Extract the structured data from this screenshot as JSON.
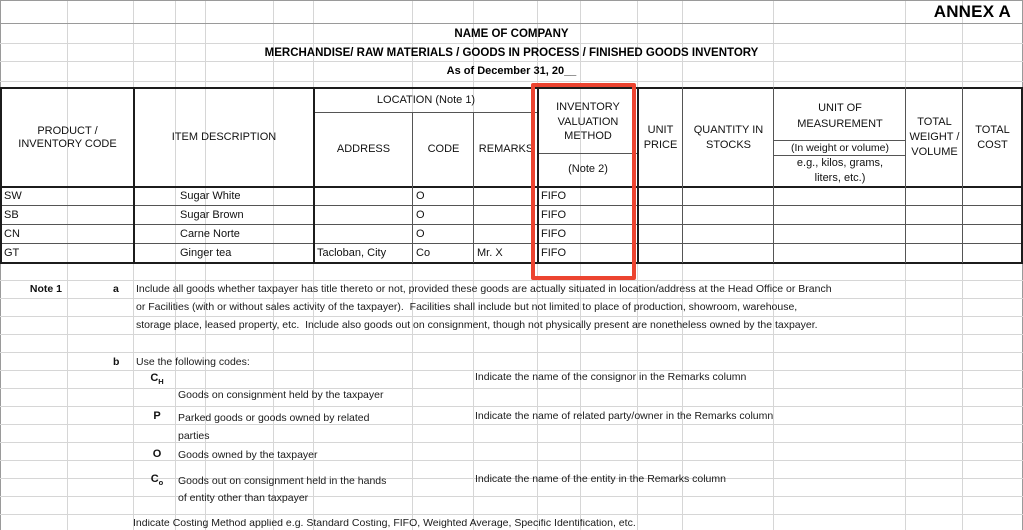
{
  "document": {
    "annex_label": "ANNEX A",
    "company_line": "NAME OF COMPANY",
    "form_title": "MERCHANDISE/ RAW MATERIALS / GOODS IN PROCESS / FINISHED GOODS INVENTORY",
    "as_of": "As of December 31, 20__"
  },
  "table": {
    "headers": {
      "product_code": "PRODUCT /\nINVENTORY CODE",
      "item_description": "ITEM DESCRIPTION",
      "location_group": "LOCATION (Note 1)",
      "address": "ADDRESS",
      "code": "CODE",
      "remarks": "REMARKS",
      "valuation_method_l1": "INVENTORY",
      "valuation_method_l2": "VALUATION",
      "valuation_method_l3": "METHOD",
      "valuation_method_note": "(Note 2)",
      "unit_price_l1": "UNIT",
      "unit_price_l2": "PRICE",
      "quantity_l1": "QUANTITY IN",
      "quantity_l2": "STOCKS",
      "uom_l1": "UNIT OF",
      "uom_l2": "MEASUREMENT",
      "uom_l3": "(In weight or volume)",
      "uom_l4": "e.g., kilos, grams,",
      "uom_l5": "liters, etc.)",
      "total_weight_l1": "TOTAL",
      "total_weight_l2": "WEIGHT /",
      "total_weight_l3": "VOLUME",
      "total_cost_l1": "TOTAL",
      "total_cost_l2": "COST"
    },
    "rows": [
      {
        "product_code": "SW",
        "item_description": "Sugar White",
        "address": "",
        "code": "O",
        "remarks": "",
        "valuation_method": "FIFO",
        "unit_price": "",
        "quantity": "",
        "uom": "",
        "total_weight": "",
        "total_cost": ""
      },
      {
        "product_code": "SB",
        "item_description": "Sugar Brown",
        "address": "",
        "code": "O",
        "remarks": "",
        "valuation_method": "FIFO",
        "unit_price": "",
        "quantity": "",
        "uom": "",
        "total_weight": "",
        "total_cost": ""
      },
      {
        "product_code": "CN",
        "item_description": "Carne Norte",
        "address": "",
        "code": "O",
        "remarks": "",
        "valuation_method": "FIFO",
        "unit_price": "",
        "quantity": "",
        "uom": "",
        "total_weight": "",
        "total_cost": ""
      },
      {
        "product_code": "GT",
        "item_description": "Ginger tea",
        "address": "Tacloban, City",
        "code": "Co",
        "remarks": "Mr. X",
        "valuation_method": "FIFO",
        "unit_price": "",
        "quantity": "",
        "uom": "",
        "total_weight": "",
        "total_cost": ""
      }
    ]
  },
  "notes": {
    "note1_label": "Note 1",
    "item_a_marker": "a",
    "item_a_line1": "Include all goods whether taxpayer has title thereto or not, provided these goods are actually situated in location/address at the Head Office or Branch",
    "item_a_line2": "or Facilities (with or without sales activity of the taxpayer).  Facilities shall include but not limited to place of production, showroom, warehouse,",
    "item_a_line3": "storage place, leased property, etc.  Include also goods out on consignment, though not physically present are nonetheless owned by the taxpayer.",
    "item_b_marker": "b",
    "item_b_title": "Use the following codes:",
    "codes": [
      {
        "symbol": "C",
        "subscript": "H",
        "description_line1": "Goods on consignment held by the taxpayer",
        "description_line2": "",
        "instruction": "Indicate the name of the consignor in the Remarks column"
      },
      {
        "symbol": "P",
        "subscript": "",
        "description_line1": "Parked goods or goods owned by related",
        "description_line2": "parties",
        "instruction": "Indicate the name of related party/owner in the Remarks column"
      },
      {
        "symbol": "O",
        "subscript": "",
        "description_line1": "Goods owned by the taxpayer",
        "description_line2": "",
        "instruction": ""
      },
      {
        "symbol": "C",
        "subscript": "o",
        "description_line1": "Goods out on consignment held in the hands",
        "description_line2": "of entity other than taxpayer",
        "instruction": "Indicate the name of the entity in the Remarks column"
      }
    ],
    "clipped_bottom_line": "Indicate Costing Method applied e.g. Standard Costing, FIFO, Weighted Average, Specific Identification, etc."
  },
  "colors": {
    "highlight_red": "#ec4430",
    "grid_line": "#d6d6d6",
    "table_border": "#1c1c1c"
  }
}
